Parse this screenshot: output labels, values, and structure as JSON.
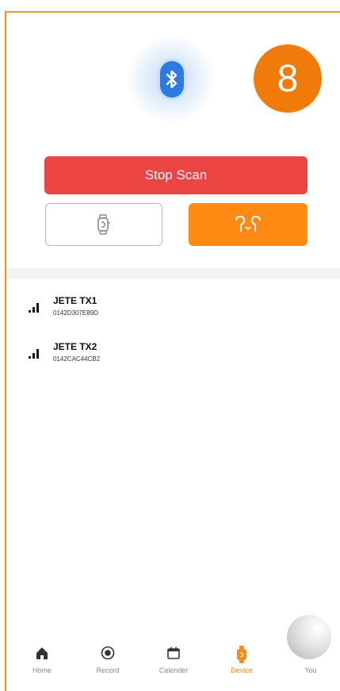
{
  "header": {
    "bluetooth_icon": "bluetooth-icon",
    "count": "8"
  },
  "scan": {
    "stop_label": "Stop Scan",
    "watch_icon": "watch-icon",
    "earbuds_icon": "earbuds-icon"
  },
  "devices": [
    {
      "name": "JETE TX1",
      "address": "0142D307E89D",
      "signal_icon": "signal-icon"
    },
    {
      "name": "JETE TX2",
      "address": "0142CAC44CB2",
      "signal_icon": "signal-icon"
    }
  ],
  "tabs": [
    {
      "label": "Home",
      "icon": "home-icon"
    },
    {
      "label": "Record",
      "icon": "record-icon"
    },
    {
      "label": "Calender",
      "icon": "calendar-icon"
    },
    {
      "label": "Device",
      "icon": "device-icon",
      "active": true
    },
    {
      "label": "You",
      "icon": "user-icon"
    }
  ],
  "colors": {
    "frame": "#f5921e",
    "count_bg": "#f07a0a",
    "stop": "#ec4343",
    "earbuds_bg": "#ff8a13",
    "bluetooth": "#2d7be0",
    "active_tab": "#f28d1d"
  }
}
